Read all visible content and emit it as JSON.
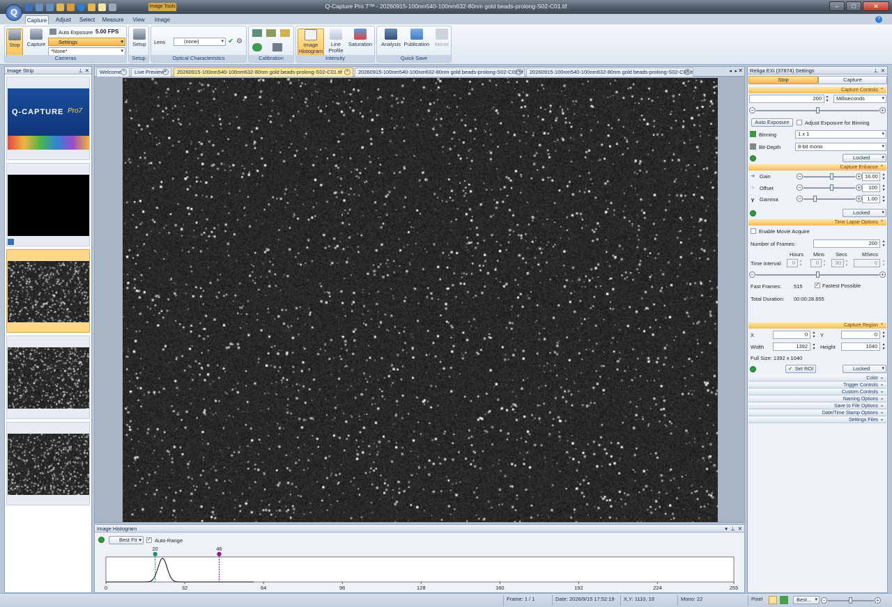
{
  "window": {
    "title": "Q-Capture Pro 7™ - 20260915-100nm540-100nm632-80nm gold beads-prolong-S02-C01.tif",
    "context_tab": "Image Tools",
    "app_logo": "Q"
  },
  "ribbon_tabs": [
    "Capture",
    "Adjust",
    "Select",
    "Measure",
    "View",
    "Image"
  ],
  "ribbon": {
    "cameras": {
      "stop": "Stop",
      "capture": "Capture",
      "auto_exposure": "Auto Exposure",
      "fps": "5.00 FPS",
      "settings": "Settings",
      "preset": "*None*",
      "label": "Cameras"
    },
    "setup": {
      "button": "Setup",
      "label": "Setup"
    },
    "optical": {
      "lens_label": "Lens",
      "lens_value": "(none)",
      "label": "Optical Characteristics"
    },
    "calibration": {
      "label": "Calibration"
    },
    "intensity": {
      "image_histogram": "Image Histogram",
      "line_profile": "Line Profile",
      "saturation": "Saturation",
      "label": "Intensity"
    },
    "quick_save": {
      "analysis": "Analysis",
      "publication": "Publication",
      "movie": "Movie",
      "label": "Quick Save"
    }
  },
  "image_strip": {
    "title": "Image Strip",
    "splash_brand": "Q-CAPTURE",
    "splash_version": "Pro7"
  },
  "doc_tabs": [
    {
      "label": "Welcome",
      "active": false
    },
    {
      "label": "Live Preview*",
      "active": false
    },
    {
      "label": "20260915-100nm540-100nm632-80nm  gold  beads-prolong-S02-C01.tif",
      "active": true
    },
    {
      "label": "20260915-100nm540-100nm632-80nm gold beads-prolong-S02-C02.tif",
      "active": false
    },
    {
      "label": "20260915-100nm540-100nm632-80nm gold beads-prolong-S02-C03.tif",
      "active": false
    }
  ],
  "histogram": {
    "title": "Image Histogram",
    "fit_label": "Best Fit",
    "auto_range_label": "Auto-Range",
    "auto_range_checked": true,
    "marker_low": 20,
    "marker_high": 46,
    "axis_ticks": [
      0,
      32,
      64,
      96,
      128,
      160,
      192,
      224,
      255
    ],
    "axis_max": 255,
    "peak_center": 23,
    "colors": {
      "low": "#1f8c8c",
      "high": "#8b1a8b"
    }
  },
  "settings": {
    "title": "Retiga EXi (37874) Settings",
    "stop_tab": "Stop",
    "capture_tab": "Capture",
    "capture_controls": {
      "header": "Capture Controls",
      "exposure_value": "200",
      "exposure_unit": "Milliseconds",
      "exposure_slider": 0.5,
      "auto_exposure": "Auto Exposure",
      "adjust_binning": "Adjust Exposure for Binning",
      "binning_label": "Binning",
      "binning_value": "1 x 1",
      "bitdepth_label": "Bit-Depth",
      "bitdepth_value": "8-bit mono",
      "locked": "Locked"
    },
    "capture_enhance": {
      "header": "Capture Enhance",
      "gain_label": "Gain",
      "gain_value": "16.00",
      "gain_slider": 0.55,
      "offset_label": "Offset",
      "offset_value": "100",
      "offset_slider": 0.55,
      "gamma_label": "Gamma",
      "gamma_value": "1.00",
      "gamma_slider": 0.2,
      "locked": "Locked"
    },
    "time_lapse": {
      "header": "Time Lapse Options",
      "enable_movie": "Enable Movie Acquire",
      "frames_label": "Number of Frames:",
      "frames_value": "200",
      "col_hours": "Hours",
      "col_mins": "Mins",
      "col_secs": "Secs",
      "col_msecs": "MSecs",
      "interval_label": "Time Interval:",
      "hours": "0",
      "mins": "0",
      "secs": "30",
      "msecs": "0",
      "interval_slider": 0.5,
      "fast_label": "Fast Frames:",
      "fast_value": "515",
      "fastest_possible": "Fastest Possible",
      "duration_label": "Total Duration:",
      "duration_value": "00:00:28.855"
    },
    "capture_region": {
      "header": "Capture Region",
      "x_label": "X",
      "x_value": "0",
      "y_label": "Y",
      "y_value": "0",
      "width_label": "Width",
      "width_value": "1392",
      "height_label": "Height",
      "height_value": "1040",
      "full_size": "Full Size: 1392 x 1040",
      "set_roi": "Set ROI",
      "locked": "Locked"
    },
    "collapsed_sections": [
      "Color",
      "Trigger Controls",
      "Custom Controls",
      "Naming Options",
      "Save to File Options",
      "Date/Time Stamp Options",
      "Settings Files"
    ]
  },
  "status": {
    "frame": "Frame: 1 / 1",
    "date": "Date: 2026/9/15 17:52:19",
    "xy": "X,Y: 1110,   19",
    "mono": "Mono:   22",
    "unit": "Pixel",
    "zoom": "Best..."
  }
}
